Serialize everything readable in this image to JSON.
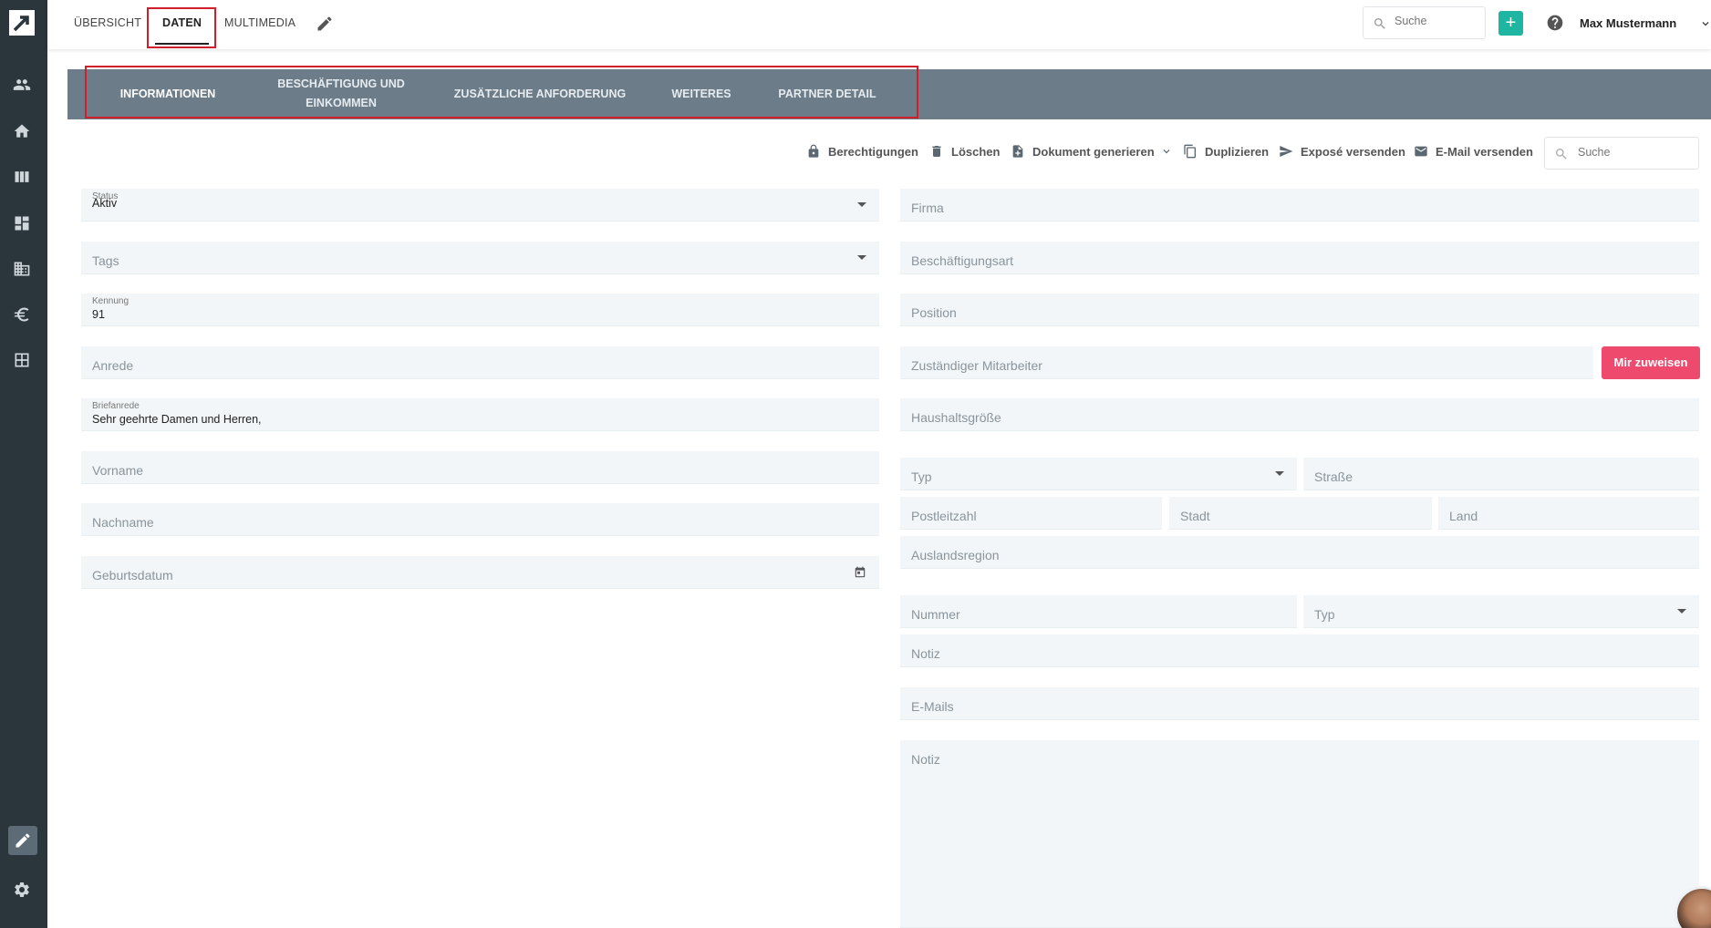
{
  "top_tabs": {
    "overview": "ÜBERSICHT",
    "data": "DATEN",
    "media": "MULTIMEDIA"
  },
  "top_search": {
    "placeholder": "Suche"
  },
  "user": {
    "name": "Max Mustermann"
  },
  "sub_tabs": {
    "informationen": "INFORMATIONEN",
    "beschaeftigung_line1": "BESCHÄFTIGUNG UND",
    "beschaeftigung_line2": "EINKOMMEN",
    "zusaetzlich": "ZUSÄTZLICHE ANFORDERUNG",
    "weiteres": "WEITERES",
    "partner": "PARTNER DETAIL"
  },
  "toolbar": {
    "permissions": "Berechtigungen",
    "delete": "Löschen",
    "generate_document": "Dokument generieren",
    "duplicate": "Duplizieren",
    "send_expose": "Exposé versenden",
    "send_email": "E-Mail versenden",
    "search_placeholder": "Suche"
  },
  "left_fields": {
    "status_label": "Status",
    "status_value": "Aktiv",
    "tags": "Tags",
    "kennung_label": "Kennung",
    "kennung_value": "91",
    "anrede": "Anrede",
    "briefanrede_label": "Briefanrede",
    "briefanrede_value": "Sehr geehrte Damen und Herren,",
    "vorname": "Vorname",
    "nachname": "Nachname",
    "geburtsdatum": "Geburtsdatum"
  },
  "right_fields": {
    "firma": "Firma",
    "beschaeftigungsart": "Beschäftigungsart",
    "position": "Position",
    "mitarbeiter": "Zuständiger Mitarbeiter",
    "assign_button": "Mir zuweisen",
    "haushaltsgroesse": "Haushaltsgröße",
    "address_type": "Typ",
    "strasse": "Straße",
    "plz": "Postleitzahl",
    "stadt": "Stadt",
    "land": "Land",
    "auslandsregion": "Auslandsregion",
    "nummer": "Nummer",
    "phone_type": "Typ",
    "notiz_phone": "Notiz",
    "emails": "E-Mails",
    "notiz": "Notiz"
  },
  "colors": {
    "sidebar": "#2b353c",
    "tabbar": "#6c7c89",
    "accent_teal": "#1fb5a3",
    "assign_pink": "#ee4a6e",
    "highlight_red": "#d01e2a"
  }
}
